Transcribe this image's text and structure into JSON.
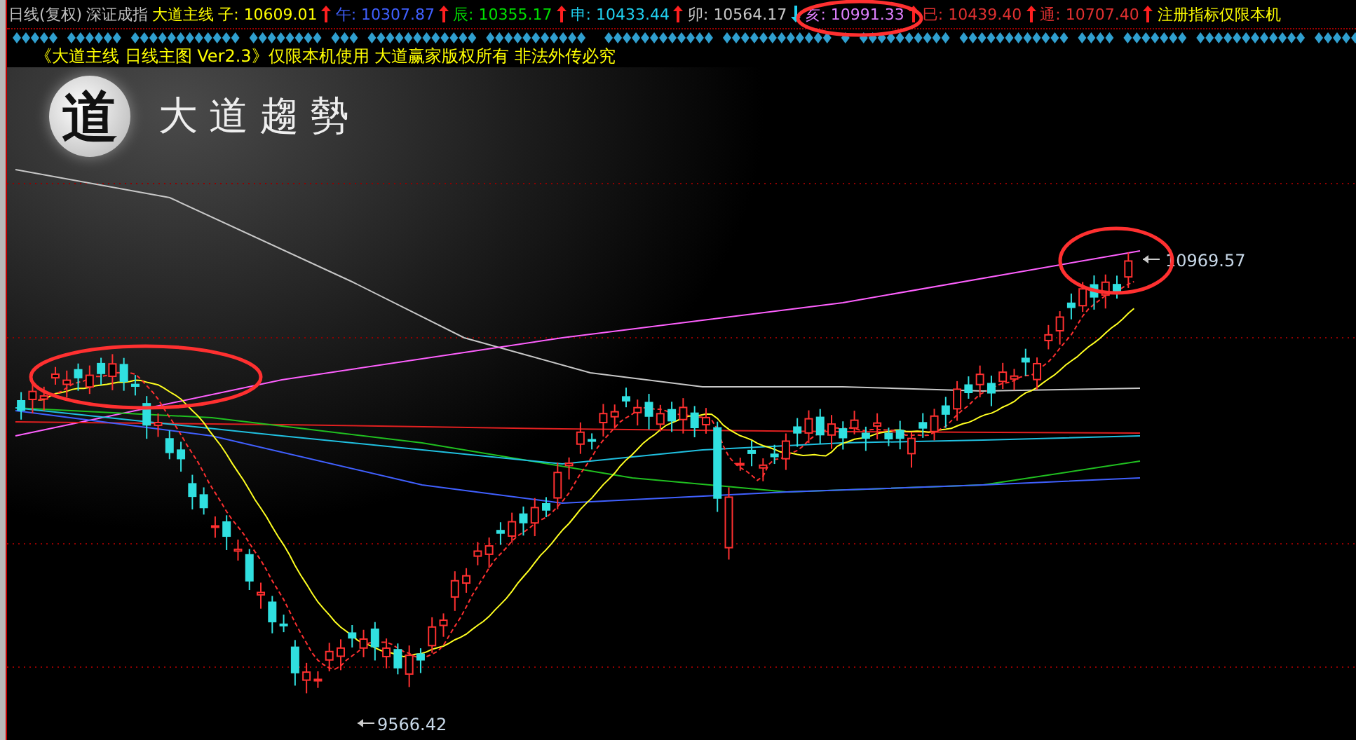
{
  "header": {
    "period": "日线(复权)",
    "index_name": "深证成指",
    "indicator": "大道主线",
    "readings": [
      {
        "label": "子:",
        "value": "10609.01",
        "color": "#ffff00",
        "rising": true
      },
      {
        "label": "午:",
        "value": "10307.87",
        "color": "#4060ff",
        "rising": true
      },
      {
        "label": "辰:",
        "value": "10355.17",
        "color": "#00e000",
        "rising": true
      },
      {
        "label": "申:",
        "value": "10433.44",
        "color": "#20d0f0",
        "rising": true
      },
      {
        "label": "卯:",
        "value": "10564.17",
        "color": "#c8c8c8",
        "rising": false
      },
      {
        "label": "亥:",
        "value": "10991.33",
        "color": "#e080ff",
        "rising": true
      },
      {
        "label": "巳:",
        "value": "10439.40",
        "color": "#e03030",
        "rising": true
      },
      {
        "label": "通:",
        "value": "10707.40",
        "color": "#e03030",
        "rising": true
      }
    ],
    "notice": "注册指标仅限本机"
  },
  "subtitle": "《大道主线 日线主图 Ver2.3》仅限本机使用 大道赢家版权所有 非法外传必究",
  "logo": {
    "emblem": "道",
    "text": "大道趨勢"
  },
  "chart": {
    "high_label": "10969.57",
    "low_label": "9566.42"
  }
}
